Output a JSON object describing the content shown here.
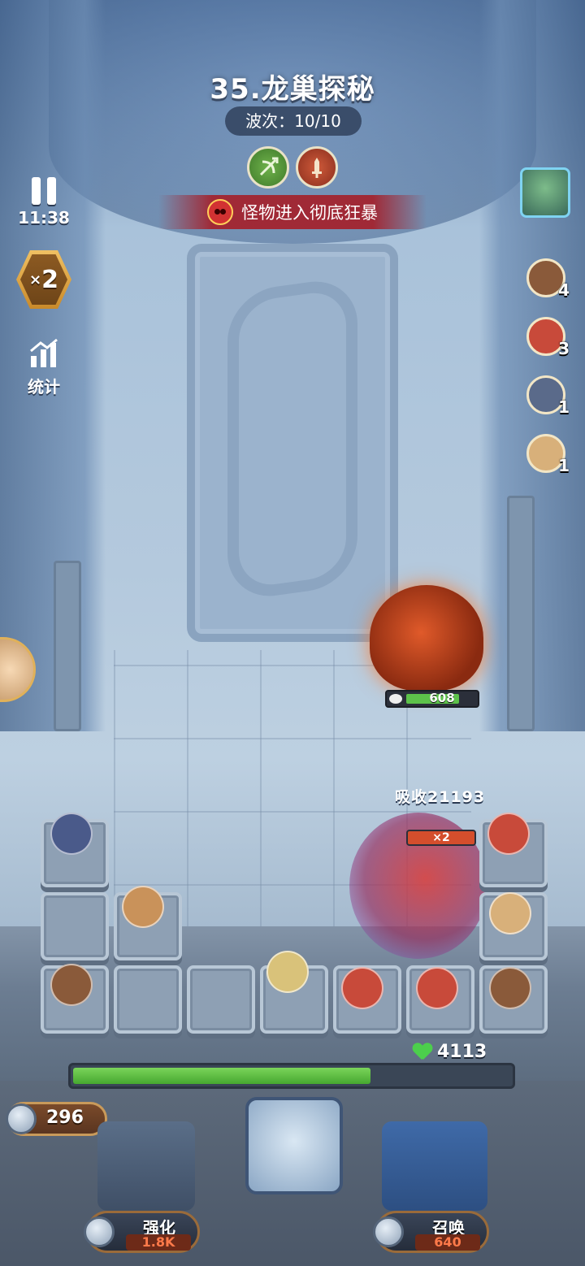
{
  "header": {
    "stage_title": "35.龙巢探秘",
    "wave_label": "波次：",
    "wave_value": "10/10",
    "buffs": [
      {
        "name": "bow-buff-icon",
        "color": "#4f8f35"
      },
      {
        "name": "sword-buff-icon",
        "color": "#b5452a"
      }
    ],
    "rage_text": "怪物进入彻底狂暴"
  },
  "controls": {
    "timer": "11:38",
    "speed": "2",
    "speed_prefix": "×",
    "stats_label": "统计"
  },
  "hero_counts": [
    {
      "count": "4",
      "color": "#8a5a3a"
    },
    {
      "count": "3",
      "color": "#c84a3a"
    },
    {
      "count": "1",
      "color": "#5a6a8a"
    },
    {
      "count": "1",
      "color": "#d8b07a"
    }
  ],
  "enemies": {
    "boar_hp": "608",
    "boar_hp_fraction": 0.75,
    "absorb_text": "吸收21193",
    "golem_shield": "×2"
  },
  "base": {
    "hp": "4113",
    "hp_fraction": 0.68,
    "coins": "296"
  },
  "actions": {
    "upgrade_label": "强化",
    "upgrade_cost": "1.8K",
    "summon_label": "召唤",
    "summon_cost": "640"
  },
  "colors": {
    "accent_green": "#5dc24a",
    "cost_red": "#ff7a4a",
    "rage_red": "#a51e28"
  }
}
